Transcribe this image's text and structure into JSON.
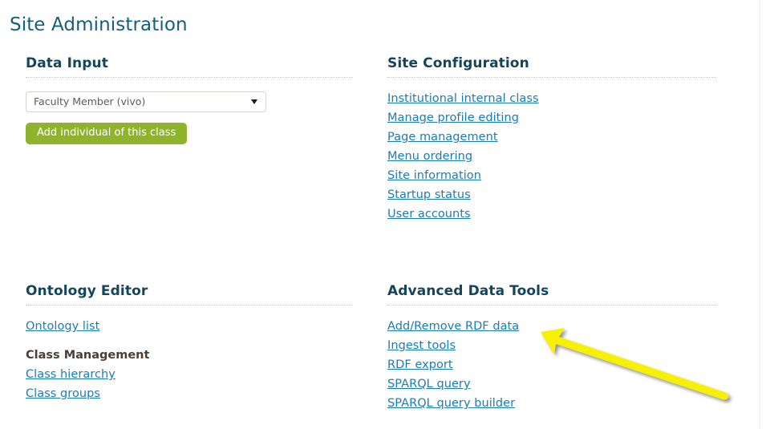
{
  "page": {
    "title": "Site Administration"
  },
  "panels": {
    "data_input": {
      "heading": "Data Input",
      "select": {
        "value": "Faculty Member (vivo)",
        "caret_icon": "chevron-down-icon"
      },
      "add_button": "Add individual of this class"
    },
    "site_configuration": {
      "heading": "Site Configuration",
      "links": [
        "Institutional internal class",
        "Manage profile editing",
        "Page management",
        "Menu ordering",
        "Site information",
        "Startup status",
        "User accounts"
      ]
    },
    "ontology_editor": {
      "heading": "Ontology Editor",
      "links": [
        "Ontology list"
      ],
      "class_management": {
        "label": "Class Management",
        "links": [
          "Class hierarchy",
          "Class groups"
        ]
      }
    },
    "advanced_data_tools": {
      "heading": "Advanced Data Tools",
      "links": [
        "Add/Remove RDF data",
        "Ingest tools",
        "RDF export",
        "SPARQL query",
        "SPARQL query builder"
      ]
    }
  },
  "annotation": {
    "arrow_icon": "arrow-pointing-up-left",
    "color": "#f7f000"
  },
  "colors": {
    "page_title": "#165e7e",
    "heading": "#13455c",
    "link": "#1a7cb5",
    "button_green": "#8fb32c",
    "sublabel": "#4a3f33",
    "divider": "#c9c5c0",
    "background": "#ffffff"
  }
}
